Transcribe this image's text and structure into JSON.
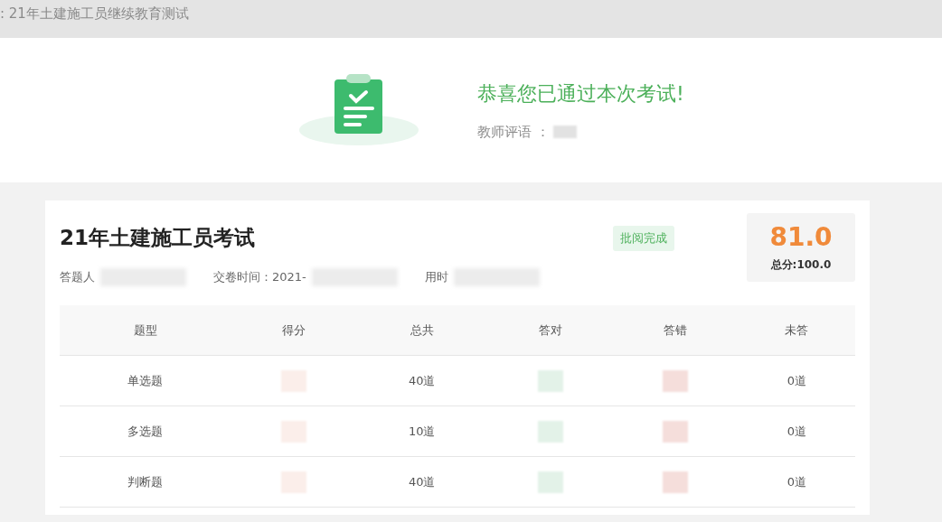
{
  "header": {
    "title": ": 21年土建施工员继续教育测试"
  },
  "result": {
    "message": "恭喜您已通过本次考试!",
    "comment_label": "教师评语 ："
  },
  "exam": {
    "title": "21年土建施工员考试",
    "status": "批阅完成",
    "score": "81.0",
    "total": "总分:100.0",
    "meta": [
      {
        "label": "答题人",
        "blurred": true
      },
      {
        "label": "交卷时间：2021-",
        "blurred": true
      },
      {
        "label": "用时",
        "blurred": true
      }
    ]
  },
  "table": {
    "columns": [
      "题型",
      "得分",
      "总共",
      "答对",
      "答错",
      "未答"
    ],
    "rows": [
      [
        {
          "kind": "text",
          "text": "单选题"
        },
        {
          "kind": "blurred",
          "color": "#fbeeea"
        },
        {
          "kind": "text",
          "text": "40道"
        },
        {
          "kind": "blurred",
          "color": "#e3f2e8"
        },
        {
          "kind": "blurred",
          "color": "#f5dedb"
        },
        {
          "kind": "text",
          "text": "0道"
        }
      ],
      [
        {
          "kind": "text",
          "text": "多选题"
        },
        {
          "kind": "blurred",
          "color": "#fbeeea"
        },
        {
          "kind": "text",
          "text": "10道"
        },
        {
          "kind": "blurred",
          "color": "#e3f2e8"
        },
        {
          "kind": "blurred",
          "color": "#f5dedb"
        },
        {
          "kind": "text",
          "text": "0道"
        }
      ],
      [
        {
          "kind": "text",
          "text": "判断题"
        },
        {
          "kind": "blurred",
          "color": "#fbeeea"
        },
        {
          "kind": "text",
          "text": "40道"
        },
        {
          "kind": "blurred",
          "color": "#e3f2e8"
        },
        {
          "kind": "blurred",
          "color": "#f5dedb"
        },
        {
          "kind": "text",
          "text": "0道"
        }
      ]
    ]
  }
}
